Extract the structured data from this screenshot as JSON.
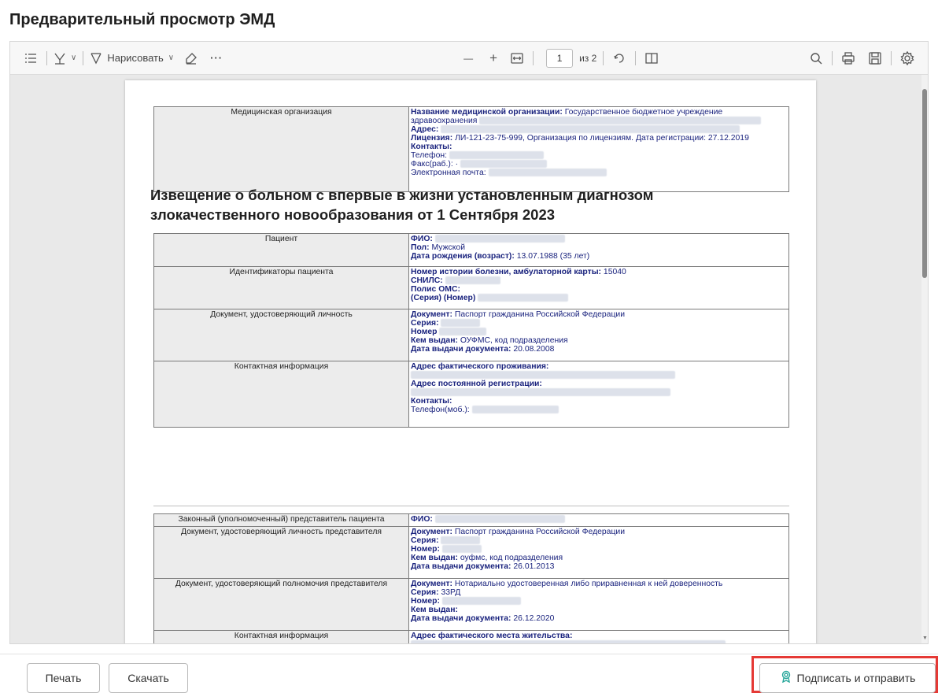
{
  "title": "Предварительный просмотр ЭМД",
  "toolbar": {
    "draw_label": "Нарисовать",
    "more": "···",
    "zoom_out": "—",
    "zoom_in": "+",
    "page_current": "1",
    "page_total": "из 2"
  },
  "org_table": {
    "label": "Медицинская организация",
    "name_key": "Название медицинской организации:",
    "name_val": "Государственное бюджетное учреждение здравоохранения",
    "address_key": "Адрес:",
    "license_key": "Лицензия:",
    "license_val": "ЛИ-121-23-75-999, Организация по лицензиям. Дата регистрации: 27.12.2019",
    "contacts_key": "Контакты:",
    "phone_key": "Телефон:",
    "fax_key": "Факс(раб.): ·",
    "email_key": "Электронная почта:"
  },
  "heading": "Извещение о больном с впервые в жизни установленным диагнозом злокачественного новообразования от 1 Сентября 2023",
  "patient_table": {
    "patient_label": "Пациент",
    "fio_key": "ФИО:",
    "sex_key": "Пол:",
    "sex_val": "Мужской",
    "dob_key": "Дата рождения (возраст):",
    "dob_val": "13.07.1988 (35 лет)",
    "ids_label": "Идентификаторы пациента",
    "history_key": "Номер истории болезни, амбулаторной карты:",
    "history_val": "15040",
    "snils_key": "СНИЛС:",
    "oms_key": "Полис ОМС:",
    "series_number_key": "(Серия) (Номер)",
    "doc_label": "Документ, удостоверяющий личность",
    "doc_key": "Документ:",
    "doc_val": "Паспорт гражданина Российской Федерации",
    "series_key": "Серия:",
    "number_key": "Номер",
    "issued_key": "Кем выдан:",
    "issued_val": "ОУФМС, код подразделения",
    "issue_date_key": "Дата выдачи документа:",
    "issue_date_val": "20.08.2008",
    "contact_label": "Контактная информация",
    "actual_addr_key": "Адрес фактического проживания:",
    "reg_addr_key": "Адрес постоянной регистрации:",
    "contacts_key": "Контакты:",
    "mobile_key": "Телефон(моб.):"
  },
  "rep_table": {
    "rep_label": "Законный (уполномоченный) представитель пациента",
    "fio_key": "ФИО:",
    "rep_doc_label": "Документ, удостоверяющий личность представителя",
    "doc_key": "Документ:",
    "doc_val": "Паспорт гражданина Российской Федерации",
    "series_key": "Серия:",
    "number_key": "Номер:",
    "issued_key": "Кем выдан:",
    "issued_val": "оуфмс, код подразделения",
    "issue_date_key": "Дата выдачи документа:",
    "issue_date_val": "26.01.2013",
    "auth_label": "Документ, удостоверяющий полномочия представителя",
    "auth_doc_key": "Документ:",
    "auth_doc_val": "Нотариально удостоверенная либо приравненная к ней доверенность",
    "auth_series_key": "Серия:",
    "auth_series_val": "33РД",
    "auth_number_key": "Номер:",
    "auth_issued_key": "Кем выдан:",
    "auth_date_key": "Дата выдачи документа:",
    "auth_date_val": "26.12.2020",
    "contact_label": "Контактная информация",
    "addr_key": "Адрес фактического места жительства:"
  },
  "footer": {
    "print_label": "Печать",
    "download_label": "Скачать",
    "sign_label": "Подписать и отправить"
  },
  "colors": {
    "highlight": "#e53935",
    "accent": "#26a69a",
    "value_text": "#1a237e"
  }
}
